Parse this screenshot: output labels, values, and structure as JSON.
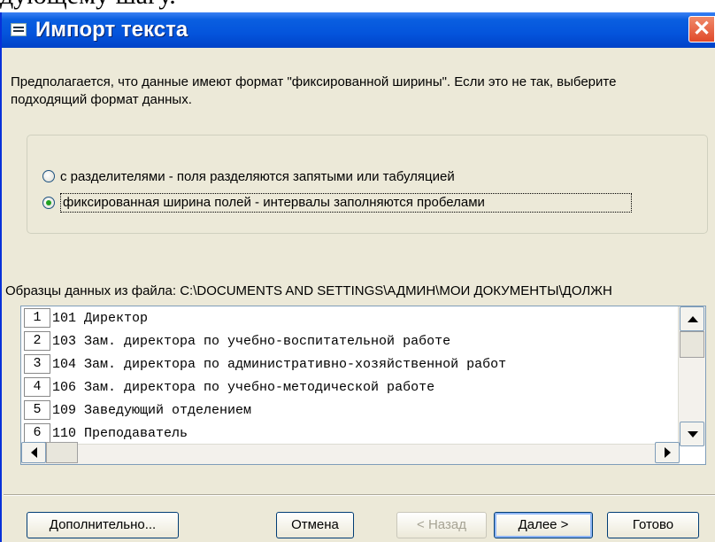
{
  "background_text": "дующему шагу.",
  "window": {
    "title": "Импорт текста",
    "close_glyph": "✕"
  },
  "intro_text": "Предполагается, что данные имеют формат \"фиксированной ширины\". Если это не так, выберите подходящий формат данных.",
  "options": [
    {
      "label": "с разделителями - поля разделяются запятыми или табуляцией",
      "checked": false
    },
    {
      "label": "фиксированная ширина полей - интервалы заполняются пробелами",
      "checked": true
    }
  ],
  "sample_label": "Образцы данных из файла: C:\\DOCUMENTS AND SETTINGS\\АДМИН\\МОИ ДОКУМЕНТЫ\\ДОЛЖН",
  "preview_rows": [
    {
      "num": "1",
      "text": "101 Директор"
    },
    {
      "num": "2",
      "text": "103 Зам. директора по учебно-воспитательной работе"
    },
    {
      "num": "3",
      "text": "104 Зам. директора по административно-хозяйственной работ"
    },
    {
      "num": "4",
      "text": "106 Зам. директора по учебно-методической работе"
    },
    {
      "num": "5",
      "text": "109 Заведующий отделением"
    },
    {
      "num": "6",
      "text": "110 Преподаватель"
    }
  ],
  "buttons": {
    "advanced": "Дополнительно...",
    "cancel": "Отмена",
    "back": "< Назад",
    "next": "Далее >",
    "finish": "Готово"
  },
  "colors": {
    "titlebar": "#0454dc",
    "dialog_bg": "#ece9d8",
    "close_button": "#e0492a"
  }
}
